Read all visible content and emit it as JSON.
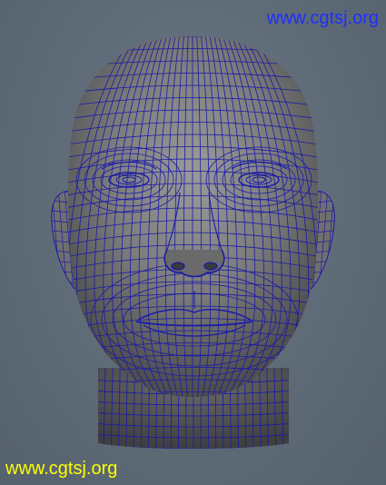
{
  "viewport": {
    "background": "#5f6c78",
    "wireframe_color": "#1a1aa8",
    "surface_color": "#7d7d7d"
  },
  "watermarks": {
    "top": {
      "text": "www.cgtsj.org",
      "color": "#1f2fff"
    },
    "bottom": {
      "text": "www.cgtsj.org",
      "color": "#ffff00"
    }
  },
  "model": {
    "subject": "head-wireframe-mesh"
  }
}
